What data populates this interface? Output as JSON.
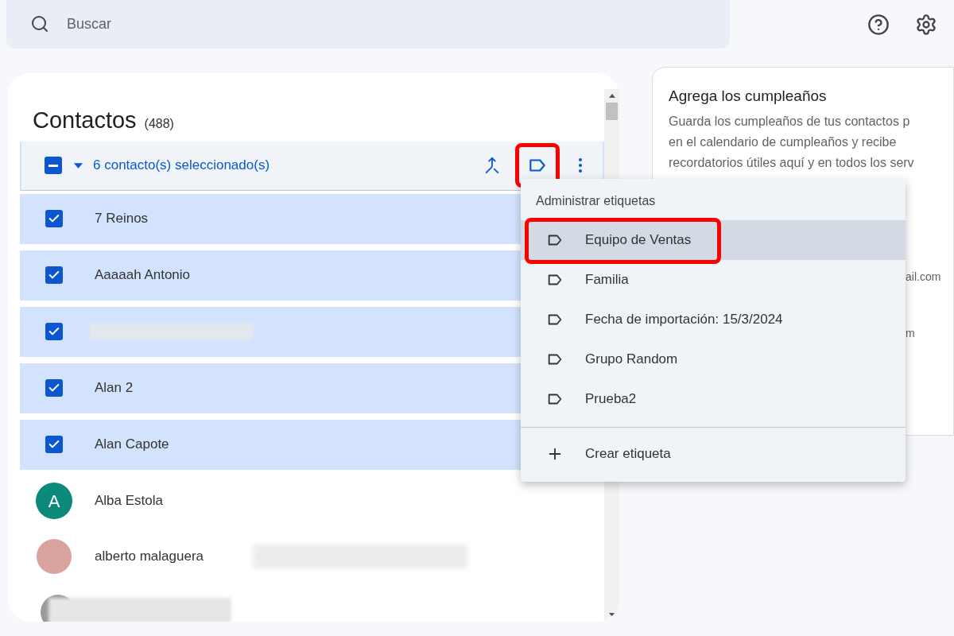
{
  "search": {
    "placeholder": "Buscar"
  },
  "contacts_panel": {
    "title": "Contactos",
    "count": "(488)",
    "selection": {
      "select_all_indeterminate": true,
      "label": "6 contacto(s) seleccionado(s)",
      "label_button_highlighted": true
    },
    "rows": [
      {
        "kind": "checkbox",
        "name": "7 Reinos",
        "checked": true
      },
      {
        "kind": "checkbox",
        "name": "Aaaaah Antonio",
        "checked": true
      },
      {
        "kind": "checkbox-blurred",
        "checked": true
      },
      {
        "kind": "checkbox",
        "name": "Alan 2",
        "checked": true
      },
      {
        "kind": "checkbox",
        "name": "Alan Capote",
        "checked": true
      },
      {
        "kind": "letter",
        "name": "Alba Estola",
        "initial": "A",
        "color": "#0b8a7a"
      },
      {
        "kind": "photo",
        "name": "alberto malaguera"
      },
      {
        "kind": "blurred"
      }
    ]
  },
  "birthday_card": {
    "title": "Agrega los cumpleaños",
    "lines": [
      "Guarda los cumpleaños de tus contactos p",
      "en el calendario de cumpleaños y recibe",
      "recordatorios útiles aquí y en todos los serv"
    ],
    "fragments": [
      "ail.com",
      "m"
    ]
  },
  "label_menu": {
    "heading": "Administrar etiquetas",
    "items": [
      {
        "kind": "label",
        "text": "Equipo de Ventas",
        "selected": true,
        "highlighted": true
      },
      {
        "kind": "label",
        "text": "Familia",
        "selected": false,
        "highlighted": false
      },
      {
        "kind": "label",
        "text": "Fecha de importación: 15/3/2024",
        "selected": false,
        "highlighted": false
      },
      {
        "kind": "label",
        "text": "Grupo Random",
        "selected": false,
        "highlighted": false
      },
      {
        "kind": "label",
        "text": "Prueba2",
        "selected": false,
        "highlighted": false
      },
      {
        "kind": "create",
        "text": "Crear etiqueta",
        "selected": false,
        "highlighted": false
      }
    ]
  }
}
